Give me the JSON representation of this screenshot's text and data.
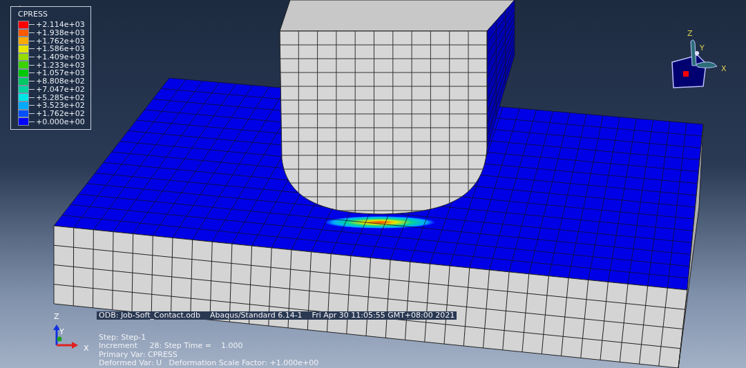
{
  "legend": {
    "title": "CPRESS",
    "items": [
      {
        "label": "+2.114e+03",
        "color": "#ff0000"
      },
      {
        "label": "+1.938e+03",
        "color": "#ff5a00"
      },
      {
        "label": "+1.762e+03",
        "color": "#ffaa00"
      },
      {
        "label": "+1.586e+03",
        "color": "#e6e600"
      },
      {
        "label": "+1.409e+03",
        "color": "#96dc00"
      },
      {
        "label": "+1.233e+03",
        "color": "#3cd200"
      },
      {
        "label": "+1.057e+03",
        "color": "#00c800"
      },
      {
        "label": "+8.808e+02",
        "color": "#00c864"
      },
      {
        "label": "+7.047e+02",
        "color": "#00d2a0"
      },
      {
        "label": "+5.285e+02",
        "color": "#00e6e6"
      },
      {
        "label": "+3.523e+02",
        "color": "#00aaff"
      },
      {
        "label": "+1.762e+02",
        "color": "#0050ff"
      },
      {
        "label": "+0.000e+00",
        "color": "#0000ff"
      }
    ]
  },
  "view_cube": {
    "z": "Z",
    "y": "Y",
    "x": "X"
  },
  "triad": {
    "z": "Z",
    "y": "Y",
    "x": "X"
  },
  "info": {
    "odb": "ODB: Job-Soft_Contact.odb    Abaqus/Standard 6.14-1    Fri Apr 30 11:05:55 GMT+08:00 2021",
    "lines": [
      "Step: Step-1",
      "Increment     28: Step Time =    1.000",
      "Primary Var: CPRESS",
      "Deformed Var: U   Deformation Scale Factor: +1.000e+00"
    ]
  }
}
